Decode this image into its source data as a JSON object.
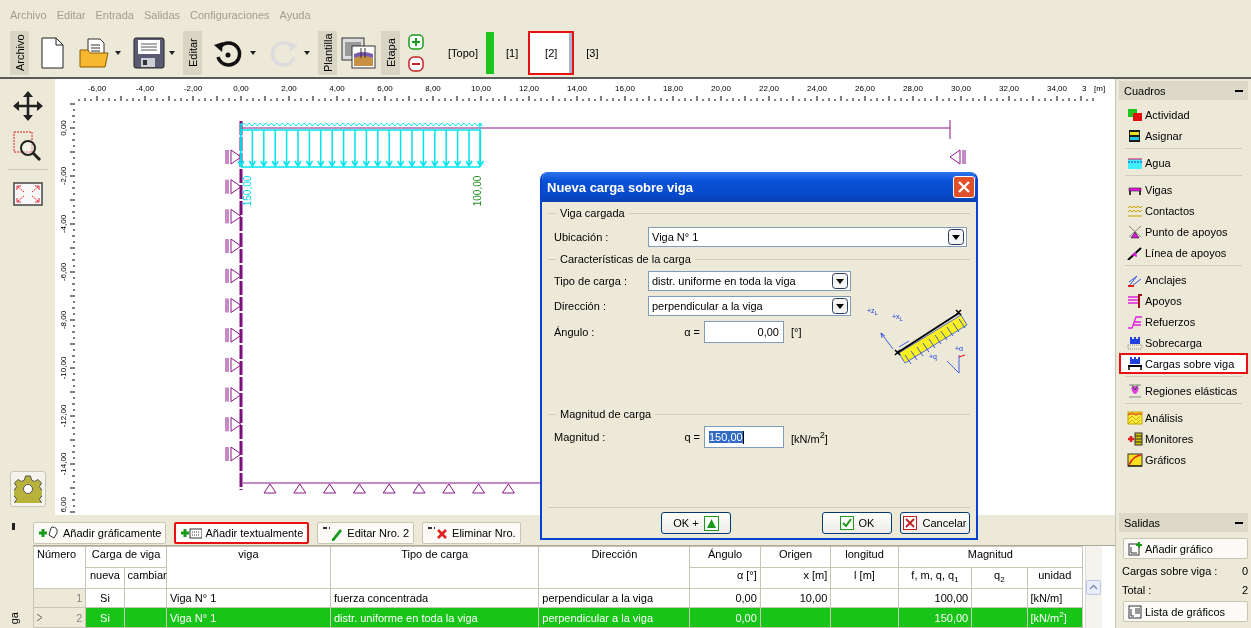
{
  "menu": [
    {
      "label": "Archivo",
      "disabled": true
    },
    {
      "label": "Editar",
      "disabled": true
    },
    {
      "label": "Entrada",
      "disabled": true
    },
    {
      "label": "Salidas",
      "disabled": true
    },
    {
      "label": "Configuraciones",
      "disabled": true
    },
    {
      "label": "Ayuda",
      "disabled": true
    }
  ],
  "toolbar": {
    "group_labels": [
      "Archivo",
      "Editar",
      "Plantilla",
      "Etapa"
    ],
    "redo_disabled": true,
    "stages": [
      {
        "label": "[Topo]",
        "selected": false,
        "highlighted": false
      },
      {
        "label": "[1]",
        "selected": false,
        "highlighted": false
      },
      {
        "label": "[2]",
        "selected": true,
        "highlighted": true
      },
      {
        "label": "[3]",
        "selected": false,
        "highlighted": false
      }
    ]
  },
  "canvas": {
    "x_labels": [
      "-6,00",
      "-4,00",
      "-2,00",
      "0,00",
      "2,00",
      "4,00",
      "6,00",
      "8,00",
      "10,00",
      "12,00",
      "14,00",
      "16,00",
      "18,00",
      "20,00",
      "22,00",
      "24,00",
      "26,00",
      "28,00",
      "30,00",
      "32,00",
      "34,00"
    ],
    "x_cut_label": "3",
    "x_unit": "[m]",
    "y_labels": [
      "0,00",
      "-2,00",
      "-4,00",
      "-6,00",
      "-8,00",
      "-10,00",
      "-12,00",
      "-14,00"
    ],
    "y_cut_label": "6,00",
    "load_labels": [
      {
        "text": "150,00",
        "color": "#00d8e8"
      },
      {
        "text": "100,00",
        "color": "#1a8c1a"
      }
    ]
  },
  "side_panel": {
    "title": "Cuadros",
    "groups": [
      [
        {
          "label": "Actividad",
          "selected": false,
          "highlighted": false
        },
        {
          "label": "Asignar",
          "selected": false,
          "highlighted": false
        }
      ],
      [
        {
          "label": "Agua",
          "selected": false,
          "highlighted": false
        }
      ],
      [
        {
          "label": "Vigas",
          "selected": false,
          "highlighted": false
        },
        {
          "label": "Contactos",
          "selected": false,
          "highlighted": false
        },
        {
          "label": "Punto de apoyos",
          "selected": false,
          "highlighted": false
        },
        {
          "label": "Línea de apoyos",
          "selected": false,
          "highlighted": false
        }
      ],
      [
        {
          "label": "Anclajes",
          "selected": false,
          "highlighted": false
        },
        {
          "label": "Apoyos",
          "selected": false,
          "highlighted": false
        },
        {
          "label": "Refuerzos",
          "selected": false,
          "highlighted": false
        },
        {
          "label": "Sobrecarga",
          "selected": false,
          "highlighted": false
        },
        {
          "label": "Cargas sobre viga",
          "selected": true,
          "highlighted": true
        }
      ],
      [
        {
          "label": "Regiones elásticas",
          "selected": false,
          "highlighted": false
        }
      ],
      [
        {
          "label": "Análisis",
          "selected": false,
          "highlighted": false
        },
        {
          "label": "Monitores",
          "selected": false,
          "highlighted": false
        },
        {
          "label": "Gráficos",
          "selected": false,
          "highlighted": false
        }
      ]
    ],
    "outputs": {
      "title": "Salidas",
      "add_button": "Añadir gráfico",
      "counts": [
        {
          "label": "Cargas sobre viga :",
          "value": "0"
        },
        {
          "label": "Total :",
          "value": "2"
        }
      ],
      "list_button": "Lista de gráficos"
    }
  },
  "bottom_panel": {
    "side_label": "ga",
    "buttons": [
      {
        "label": "Añadir gráficamente",
        "highlighted": false
      },
      {
        "label": "Añadir textualmente",
        "highlighted": true
      },
      {
        "label": "Editar Nro. 2",
        "highlighted": false
      },
      {
        "label": "Eliminar Nro.",
        "highlighted": false
      }
    ],
    "table": {
      "header_top": [
        "Número",
        "Carga de viga",
        "viga",
        "Tipo de carga",
        "Dirección",
        "Ángulo",
        "Origen",
        "longitud",
        "Magnitud"
      ],
      "header_sub": [
        "nueva",
        "cambiar",
        "α [°]",
        "x [m]",
        "l [m]",
        "f, m, q, q$_{1}$",
        "q$_{2}$",
        "unidad"
      ],
      "rows": [
        {
          "selected": false,
          "cells": {
            "number": "1",
            "new": "Si",
            "beam": "Viga N° 1",
            "load_type": "fuerza concentrada",
            "direction": "perpendicular a la viga",
            "angle": "0,00",
            "origin": "10,00",
            "magnitude": "100,00",
            "unit": "[kN/m]"
          }
        },
        {
          "selected": true,
          "cells": {
            "number": "2",
            "new": "Si",
            "beam": "Viga N° 1",
            "load_type": "distr. uniforme en toda la viga",
            "direction": "perpendicular a la viga",
            "angle": "0,00",
            "magnitude": "150,00",
            "unit": "[kN/m$^{2}$]"
          }
        }
      ]
    }
  },
  "dialog": {
    "title": "Nueva carga sobre viga",
    "sections": [
      {
        "title": "Viga cargada",
        "fields": [
          {
            "kind": "select",
            "label": "Ubicación :",
            "value": "Viga N° 1"
          }
        ]
      },
      {
        "title": "Características de la carga",
        "fields": [
          {
            "kind": "select",
            "label": "Tipo de carga :",
            "value": "distr. uniforme en toda la viga"
          },
          {
            "kind": "select",
            "label": "Dirección :",
            "value": "perpendicular a la viga"
          },
          {
            "kind": "number",
            "label": "Ángulo :",
            "symbol": "α =",
            "value": "0,00",
            "unit": "[°]",
            "text_selected": false
          }
        ]
      },
      {
        "title": "Magnitud de carga",
        "fields": [
          {
            "kind": "number",
            "label": "Magnitud :",
            "symbol": "q =",
            "value": "150,00",
            "unit": "[kN/m$^{2}$]",
            "text_selected": true
          }
        ]
      }
    ],
    "diagram_labels": [
      "+z$_{L}$",
      "+x$_{L}$",
      "+q",
      "+α"
    ],
    "buttons": [
      "OK +",
      "OK",
      "Cancelar"
    ]
  }
}
